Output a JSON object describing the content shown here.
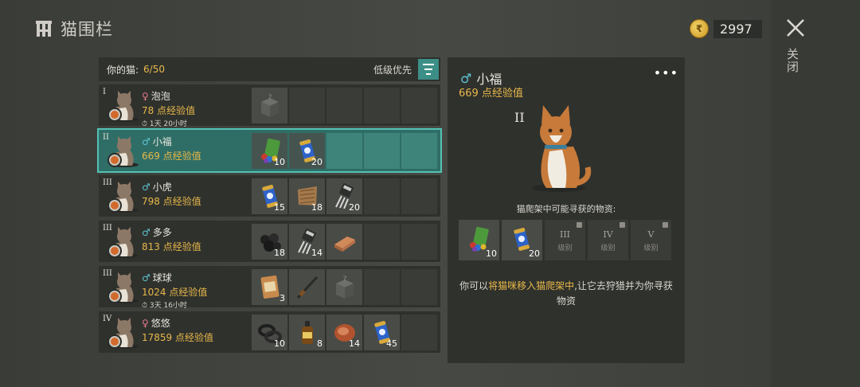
{
  "header": {
    "title": "猫围栏"
  },
  "currency": {
    "icon": "coin-icon",
    "coin_glyph": "₹",
    "value": "2997"
  },
  "close": {
    "label": "关闭"
  },
  "list": {
    "count_label": "你的猫:",
    "count_value": "6/50",
    "sort_label": "低级优先",
    "rows": [
      {
        "tier": "I",
        "gender": "♀",
        "name": "泡泡",
        "xp": "78 点经验值",
        "time": "1天 20小时",
        "slots": [
          {
            "icon": "mystery-box-icon",
            "qty": ""
          }
        ]
      },
      {
        "tier": "II",
        "gender": "♂",
        "name": "小福",
        "xp": "669 点经验值",
        "time": "",
        "slots": [
          {
            "icon": "gem-pile-icon",
            "qty": "10"
          },
          {
            "icon": "energy-can-icon",
            "qty": "20"
          }
        ]
      },
      {
        "tier": "III",
        "gender": "♂",
        "name": "小虎",
        "xp": "798 点经验值",
        "time": "",
        "slots": [
          {
            "icon": "energy-can-icon",
            "qty": "15"
          },
          {
            "icon": "fabric-icon",
            "qty": "18"
          },
          {
            "icon": "transistor-icon",
            "qty": "20"
          }
        ]
      },
      {
        "tier": "III",
        "gender": "♂",
        "name": "多多",
        "xp": "813 点经验值",
        "time": "",
        "slots": [
          {
            "icon": "coal-icon",
            "qty": "18"
          },
          {
            "icon": "transistor-icon",
            "qty": "14"
          },
          {
            "icon": "copper-bar-icon",
            "qty": ""
          }
        ]
      },
      {
        "tier": "III",
        "gender": "♂",
        "name": "球球",
        "xp": "1024 点经验值",
        "time": "3天 16小时",
        "slots": [
          {
            "icon": "seed-bag-icon",
            "qty": "3"
          },
          {
            "icon": "rifle-icon",
            "qty": ""
          },
          {
            "icon": "mystery-box-icon",
            "qty": ""
          }
        ]
      },
      {
        "tier": "IV",
        "gender": "♀",
        "name": "悠悠",
        "xp": "17859 点经验值",
        "time": "",
        "slots": [
          {
            "icon": "tire-icon",
            "qty": "10"
          },
          {
            "icon": "bottle-icon",
            "qty": "8"
          },
          {
            "icon": "meat-icon",
            "qty": "14"
          },
          {
            "icon": "energy-can-icon",
            "qty": "45"
          }
        ]
      }
    ]
  },
  "detail": {
    "gender": "♂",
    "name": "小福",
    "xp": "669 点经验值",
    "tier": "II",
    "menu": "•••",
    "hunt_title": "猫爬架中可能寻获的物资:",
    "items": [
      {
        "icon": "gem-pile-icon",
        "qty": "10"
      },
      {
        "icon": "energy-can-icon",
        "qty": "20"
      }
    ],
    "locked": [
      {
        "level": "III",
        "label": "级别"
      },
      {
        "level": "IV",
        "label": "级别"
      },
      {
        "level": "V",
        "label": "级别"
      }
    ],
    "tip_pre": "你可以",
    "tip_hl": "将猫咪移入猫爬架中",
    "tip_post": ",让它去狩猎并为你寻获物资"
  },
  "colors": {
    "accent": "#53c2b4",
    "xp": "#e8b84a",
    "male": "#5ec6d6",
    "female": "#e07a8a"
  }
}
